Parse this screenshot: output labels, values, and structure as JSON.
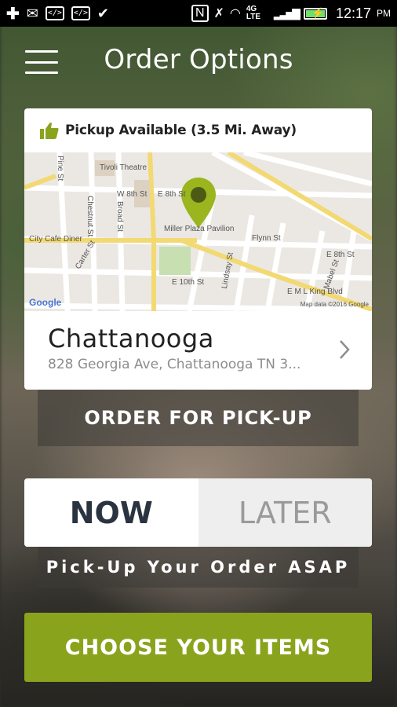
{
  "status_bar": {
    "time": "12:17",
    "ampm": "PM",
    "network": "4G LTE"
  },
  "header": {
    "title": "Order Options"
  },
  "location_card": {
    "pickup_status": "Pickup Available (3.5 Mi. Away)",
    "map": {
      "labels": [
        "Tivoli Theatre",
        "W 8th St",
        "E 8th St",
        "Miller Plaza Pavilion",
        "City Cafe Diner",
        "Flynn St",
        "E 8th St",
        "E 10th St",
        "E M L King Blvd",
        "Pine St",
        "Chestnut St",
        "Broad St",
        "Carter St",
        "Lindsay St",
        "Mabel St"
      ],
      "google": "Google",
      "credit": "Map data ©2016 Google"
    },
    "name": "Chattanooga",
    "address": "828 Georgia Ave, Chattanooga TN 3..."
  },
  "order_type_label": "ORDER FOR PICK-UP",
  "timing": {
    "now_label": "NOW",
    "later_label": "LATER",
    "selected": "NOW"
  },
  "timing_caption": "Pick-Up Your Order ASAP",
  "cta_label": "CHOOSE YOUR ITEMS",
  "colors": {
    "accent_green": "#8aa31d",
    "pin_green": "#9ab51e",
    "now_text": "#2a3440"
  }
}
